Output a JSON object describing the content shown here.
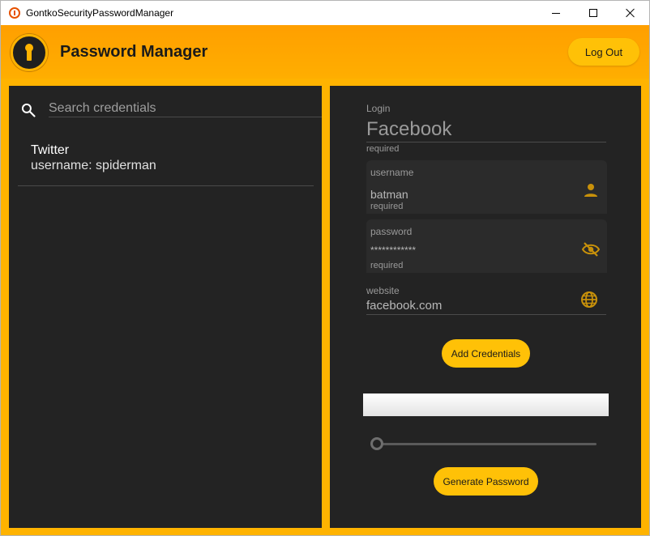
{
  "window": {
    "title": "GontkoSecurityPasswordManager",
    "controls": {
      "minimize": "minimize",
      "maximize": "maximize",
      "close": "close"
    }
  },
  "header": {
    "title": "Password Manager",
    "logout_label": "Log Out",
    "logo_icon": "keyhole-icon"
  },
  "search": {
    "placeholder": "Search credentials",
    "icon": "search-icon"
  },
  "credentials": [
    {
      "name": "Twitter",
      "username_line": "username: spiderman"
    }
  ],
  "form": {
    "login": {
      "label": "Login",
      "value": "Facebook",
      "helper": "required"
    },
    "username": {
      "label": "username",
      "value": "batman",
      "helper": "required",
      "icon": "person-icon"
    },
    "password": {
      "label": "password",
      "value": "************",
      "helper": "required",
      "icon": "eye-off-icon"
    },
    "website": {
      "label": "website",
      "value": "facebook.com",
      "icon": "globe-icon"
    },
    "add_label": "Add Credentials",
    "generated_password": "",
    "slider_value": 0,
    "generate_label": "Generate Password"
  },
  "colors": {
    "accent": "#ffc107",
    "header_bg": "#ffa000",
    "panel_bg": "#232323",
    "icon_amber": "#c8910a"
  }
}
